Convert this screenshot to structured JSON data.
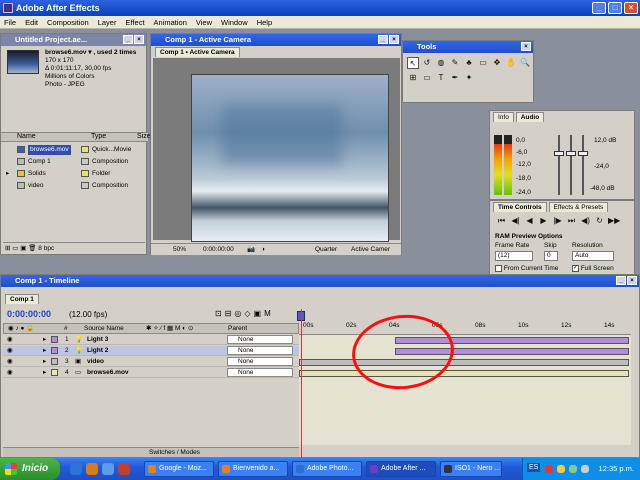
{
  "app": {
    "title": "Adobe After Effects"
  },
  "menu": [
    "File",
    "Edit",
    "Composition",
    "Layer",
    "Effect",
    "Animation",
    "View",
    "Window",
    "Help"
  ],
  "project": {
    "title": "Untitled Project.ae...",
    "file": "browse6.mov ▾ , used 2 times",
    "info": [
      "170 x 170",
      "Δ 0:01:11:17, 30,00 fps",
      "Millions of Colors",
      "Photo - JPEG"
    ],
    "cols": {
      "name": "Name",
      "type": "Type",
      "size": "Size"
    },
    "items": [
      {
        "name": "browse6.mov",
        "type": "Quick...Movie",
        "color": "#e8e070"
      },
      {
        "name": "Comp 1",
        "type": "Composition",
        "color": "#c8c8c8"
      },
      {
        "name": "Solids",
        "type": "Folder",
        "color": "#e8e070"
      },
      {
        "name": "video",
        "type": "Composition",
        "color": "#c8c8c8"
      }
    ],
    "bpc": "8 bpc"
  },
  "comp": {
    "title": "Comp 1 - Active Camera",
    "tab": "Comp 1 • Active Camera",
    "zoom": "50%",
    "timecode": "0:00:00:00",
    "resolution": "Quarter",
    "camera": "Active Camer"
  },
  "tools": {
    "title": "Tools",
    "icons": [
      "↖",
      "↺",
      "◍",
      "✎",
      "♣",
      "▭",
      "✥",
      "✋",
      "🔍",
      "⊞",
      "▭",
      "T",
      "✒",
      "✦"
    ]
  },
  "audio": {
    "tabs": [
      "Info",
      "Audio"
    ],
    "left_scale": [
      "0,0",
      "-6,0",
      "-12,0",
      "-18,0",
      "-24,0"
    ],
    "right_scale": [
      "12,0 dB",
      "-24,0",
      "-48,0 dB"
    ],
    "levels": [
      0.85,
      0.85
    ]
  },
  "time_controls": {
    "tabs": [
      "Time Controls",
      "Effects & Presets"
    ],
    "buttons": [
      "⏮",
      "◀|",
      "◀",
      "▶",
      "|▶",
      "⏭",
      "◀)",
      "↻",
      "▶▶"
    ],
    "ram_title": "RAM Preview Options",
    "labels": {
      "frame_rate": "Frame Rate",
      "skip": "Skip",
      "resolution": "Resolution"
    },
    "values": {
      "frame_rate": "(12)",
      "skip": "0",
      "resolution": "Auto"
    },
    "from_current": "From Current Time",
    "full_screen": "Full Screen"
  },
  "timeline": {
    "title": "Comp 1 - Timeline",
    "tab": "Comp 1",
    "time": "0:00:00:00",
    "fps": "(12.00 fps)",
    "cols": {
      "num": "#",
      "source": "Source Name",
      "parent": "Parent"
    },
    "ruler": [
      "00s",
      "02s",
      "04s",
      "06s",
      "08s",
      "10s",
      "12s",
      "14s"
    ],
    "layers": [
      {
        "num": "1",
        "name": "Light 3",
        "parent": "None",
        "kind": "light",
        "start": 0.29,
        "end": 1.0
      },
      {
        "num": "2",
        "name": "Light 2",
        "parent": "None",
        "kind": "light",
        "start": 0.29,
        "end": 1.0
      },
      {
        "num": "3",
        "name": "video",
        "parent": "None",
        "kind": "comp",
        "start": 0.0,
        "end": 1.0
      },
      {
        "num": "4",
        "name": "browse6.mov",
        "parent": "None",
        "kind": "footage",
        "start": 0.0,
        "end": 1.0
      }
    ],
    "footer": "Switches / Modes"
  },
  "taskbar": {
    "start": "Inicio",
    "tasks": [
      "Google - Moz...",
      "Bienvenido a...",
      "Adobe Photo...",
      "Adobe After ...",
      "ISO1 - Nero ...",
      "ES"
    ],
    "clock": "12:35 p.m."
  }
}
